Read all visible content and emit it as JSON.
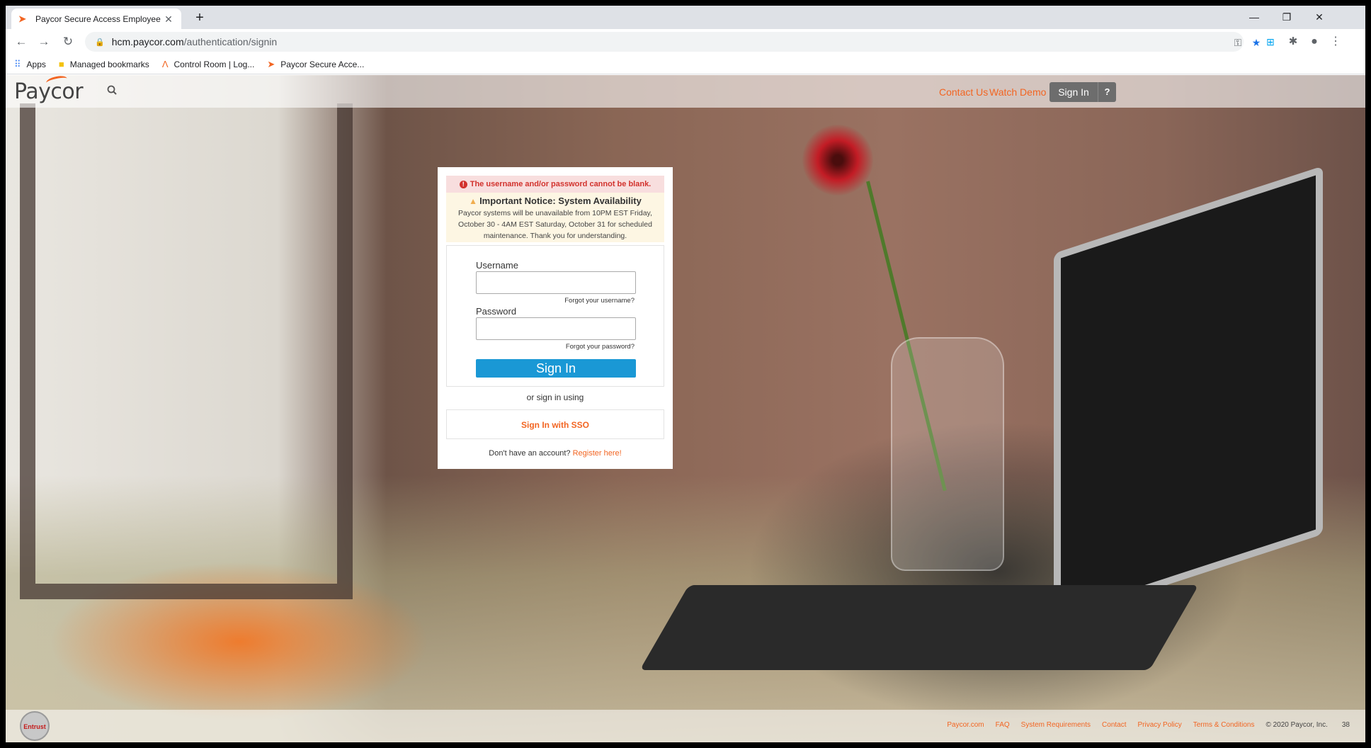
{
  "browser": {
    "tab_title": "Paycor Secure Access Employee",
    "new_tab_label": "+",
    "url_host": "hcm.paycor.com",
    "url_path": "/authentication/signin",
    "bookmarks": [
      {
        "label": "Apps",
        "icon": "apps-grid-icon"
      },
      {
        "label": "Managed bookmarks",
        "icon": "folder-icon"
      },
      {
        "label": "Control Room | Log...",
        "icon": "control-room-icon"
      },
      {
        "label": "Paycor Secure Acce...",
        "icon": "paycor-favicon-icon"
      }
    ]
  },
  "header": {
    "logo_text": "Paycor",
    "contact_link": "Contact Us",
    "demo_link": "Watch Demo",
    "signin_button": "Sign In",
    "help_button": "?"
  },
  "login": {
    "error_message": "The username and/or password cannot be blank.",
    "notice_title": "Important Notice: System Availability",
    "notice_body": "Paycor systems will be unavailable from 10PM EST Friday, October 30 - 4AM EST Saturday, October 31 for scheduled maintenance. Thank you for understanding.",
    "username_label": "Username",
    "username_value": "",
    "forgot_username": "Forgot your username?",
    "password_label": "Password",
    "password_value": "",
    "forgot_password": "Forgot your password?",
    "submit_label": "Sign In",
    "or_text": "or sign in using",
    "sso_label": "Sign In with SSO",
    "register_prompt": "Don't have an account?",
    "register_link": "Register here!"
  },
  "footer": {
    "seal_text": "Entrust",
    "links": [
      "Paycor.com",
      "FAQ",
      "System Requirements",
      "Contact",
      "Privacy Policy",
      "Terms & Conditions"
    ],
    "copyright": "© 2020 Paycor, Inc.",
    "page_number": "38"
  },
  "colors": {
    "brand_orange": "#f26522",
    "primary_blue": "#1a98d5",
    "error_red": "#d2322d"
  }
}
